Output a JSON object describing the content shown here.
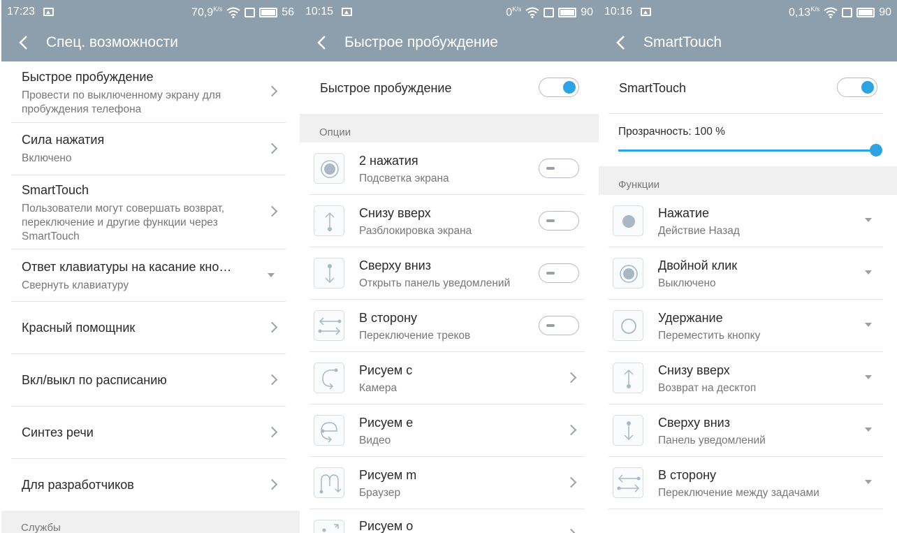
{
  "colors": {
    "header": "#8d9fac",
    "accent": "#2ea3e3",
    "divider": "#e2e2e2",
    "section_bg": "#f0f0f0"
  },
  "panel1": {
    "status": {
      "time": "17:23",
      "speed": "70,9",
      "speed_unit": "K/s",
      "battery": "56"
    },
    "title": "Спец. возможности",
    "items": [
      {
        "title": "Быстрое пробуждение",
        "subtitle": "Провести по выключенному экрану для пробуждения телефона",
        "control": "chevron"
      },
      {
        "title": "Сила нажатия",
        "subtitle": "Включено",
        "control": "chevron"
      },
      {
        "title": "SmartTouch",
        "subtitle": "Пользователи могут совершать возврат, переключение и другие функции через SmartTouch",
        "control": "chevron"
      },
      {
        "title": "Ответ клавиатуры на касание кно…",
        "subtitle": "Свернуть клавиатуру",
        "control": "dropdown"
      },
      {
        "title": "Красный помощник",
        "control": "chevron"
      },
      {
        "title": "Вкл/выкл по расписанию",
        "control": "chevron"
      },
      {
        "title": "Синтез речи",
        "control": "chevron"
      },
      {
        "title": "Для разработчиков",
        "control": "chevron"
      }
    ],
    "section": "Службы"
  },
  "panel2": {
    "status": {
      "time": "10:15",
      "speed": "0",
      "speed_unit": "K/s",
      "battery": "90"
    },
    "title": "Быстрое пробуждение",
    "main_toggle": {
      "label": "Быстрое пробуждение",
      "on": true
    },
    "section": "Опции",
    "items": [
      {
        "title": "2 нажатия",
        "subtitle": "Подсветка экрана",
        "icon": "double-tap-icon",
        "control": "toggle-off"
      },
      {
        "title": "Снизу вверх",
        "subtitle": "Разблокировка экрана",
        "icon": "swipe-up-icon",
        "control": "toggle-off"
      },
      {
        "title": "Сверху вниз",
        "subtitle": "Открыть панель уведомлений",
        "icon": "swipe-down-icon",
        "control": "toggle-off"
      },
      {
        "title": "В сторону",
        "subtitle": "Переключение треков",
        "icon": "swipe-sideways-icon",
        "control": "toggle-off"
      },
      {
        "title": "Рисуем c",
        "subtitle": "Камера",
        "icon": "draw-c-icon",
        "control": "chevron"
      },
      {
        "title": "Рисуем e",
        "subtitle": "Видео",
        "icon": "draw-e-icon",
        "control": "chevron"
      },
      {
        "title": "Рисуем m",
        "subtitle": "Браузер",
        "icon": "draw-m-icon",
        "control": "chevron"
      },
      {
        "title": "Рисуем o",
        "subtitle": "",
        "icon": "draw-o-icon",
        "control": "chevron"
      }
    ]
  },
  "panel3": {
    "status": {
      "time": "10:16",
      "speed": "0,13",
      "speed_unit": "K/s",
      "battery": "90"
    },
    "title": "SmartTouch",
    "main_toggle": {
      "label": "SmartTouch",
      "on": true
    },
    "transparency": {
      "label": "Прозрачность: 100 %",
      "value": 100
    },
    "section": "Функции",
    "items": [
      {
        "title": "Нажатие",
        "subtitle": "Действие Назад",
        "icon": "tap-icon"
      },
      {
        "title": "Двойной клик",
        "subtitle": "Выключено",
        "icon": "double-click-icon"
      },
      {
        "title": "Удержание",
        "subtitle": "Переместить кнопку",
        "icon": "hold-icon"
      },
      {
        "title": "Снизу вверх",
        "subtitle": "Возврат на десктоп",
        "icon": "swipe-up-icon"
      },
      {
        "title": "Сверху вниз",
        "subtitle": "Панель уведомлений",
        "icon": "swipe-down-icon"
      },
      {
        "title": "В сторону",
        "subtitle": "Переключение между задачами",
        "icon": "swipe-sideways-icon"
      }
    ]
  }
}
